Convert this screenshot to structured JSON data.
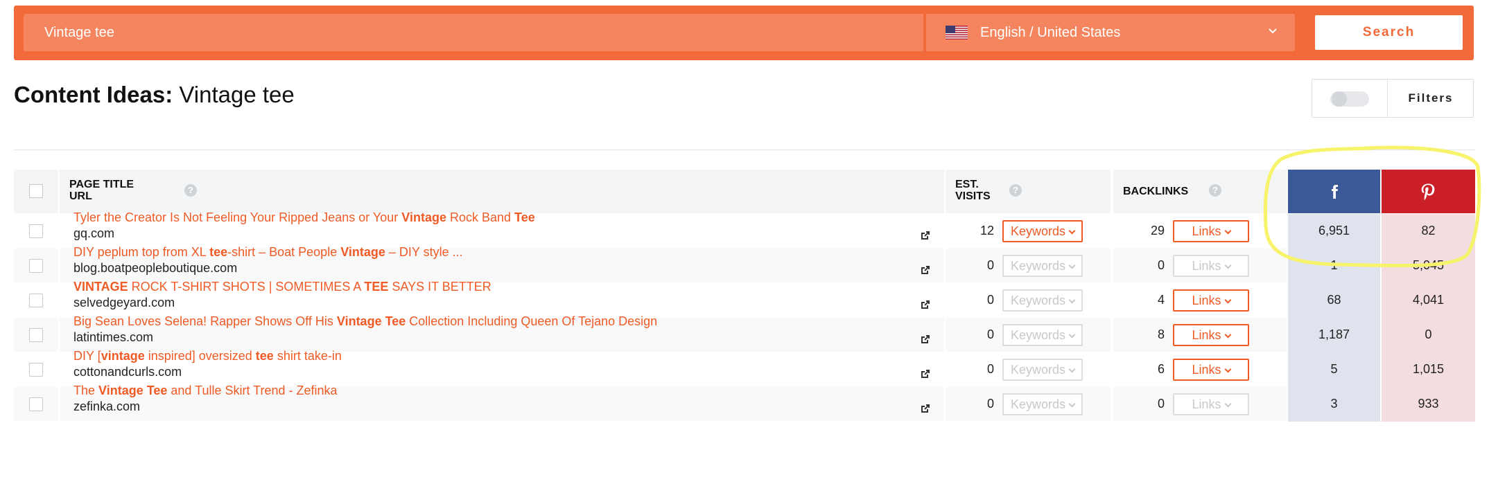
{
  "search": {
    "query": "Vintage tee",
    "language": "English / United States",
    "button": "Search"
  },
  "page": {
    "title_prefix": "Content Ideas:",
    "title_query": "Vintage tee",
    "filters_label": "Filters"
  },
  "table": {
    "headers": {
      "title": "PAGE TITLE",
      "url": "URL",
      "visits_top": "EST.",
      "visits_bottom": "VISITS",
      "backlinks": "BACKLINKS",
      "help": "?"
    },
    "keywords_label": "Keywords",
    "links_label": "Links",
    "rows": [
      {
        "title": [
          "Tyler the Creator Is Not Feeling Your Ripped Jeans or Your ",
          "Vintage",
          " Rock Band ",
          "Tee",
          ""
        ],
        "domain": "gq.com",
        "visits": "12",
        "keywords_active": true,
        "backlinks": "29",
        "links_active": true,
        "facebook": "6,951",
        "pinterest": "82"
      },
      {
        "title": [
          "DIY peplum top from XL ",
          "tee",
          "-shirt – Boat People ",
          "Vintage",
          " – DIY style ..."
        ],
        "domain": "blog.boatpeopleboutique.com",
        "visits": "0",
        "keywords_active": false,
        "backlinks": "0",
        "links_active": false,
        "facebook": "1",
        "pinterest": "5,045"
      },
      {
        "title": [
          "",
          "VINTAGE",
          " ROCK T-SHIRT SHOTS | SOMETIMES A ",
          "TEE",
          " SAYS IT BETTER"
        ],
        "domain": "selvedgeyard.com",
        "visits": "0",
        "keywords_active": false,
        "backlinks": "4",
        "links_active": true,
        "facebook": "68",
        "pinterest": "4,041"
      },
      {
        "title": [
          "Big Sean Loves Selena! Rapper Shows Off His ",
          "Vintage Tee",
          " Collection Including Queen Of Tejano Design",
          "",
          ""
        ],
        "domain": "latintimes.com",
        "visits": "0",
        "keywords_active": false,
        "backlinks": "8",
        "links_active": true,
        "facebook": "1,187",
        "pinterest": "0"
      },
      {
        "title": [
          "DIY [",
          "vintage",
          " inspired] oversized ",
          "tee",
          " shirt take-in"
        ],
        "domain": "cottonandcurls.com",
        "visits": "0",
        "keywords_active": false,
        "backlinks": "6",
        "links_active": true,
        "facebook": "5",
        "pinterest": "1,015"
      },
      {
        "title": [
          "The ",
          "Vintage Tee",
          " and Tulle Skirt Trend - Zefinka",
          "",
          ""
        ],
        "domain": "zefinka.com",
        "visits": "0",
        "keywords_active": false,
        "backlinks": "0",
        "links_active": false,
        "facebook": "3",
        "pinterest": "933"
      }
    ]
  },
  "icons": {
    "facebook": "facebook-icon",
    "pinterest": "pinterest-icon",
    "external": "external-link-icon",
    "flag": "us-flag-icon"
  },
  "colors": {
    "accent": "#f2693a",
    "link": "#ef5a25",
    "facebook": "#3b5998",
    "facebook_cell": "#dfe3ee",
    "pinterest": "#cb2027",
    "pinterest_cell": "#f4dde0",
    "highlight": "#f7f36a"
  }
}
